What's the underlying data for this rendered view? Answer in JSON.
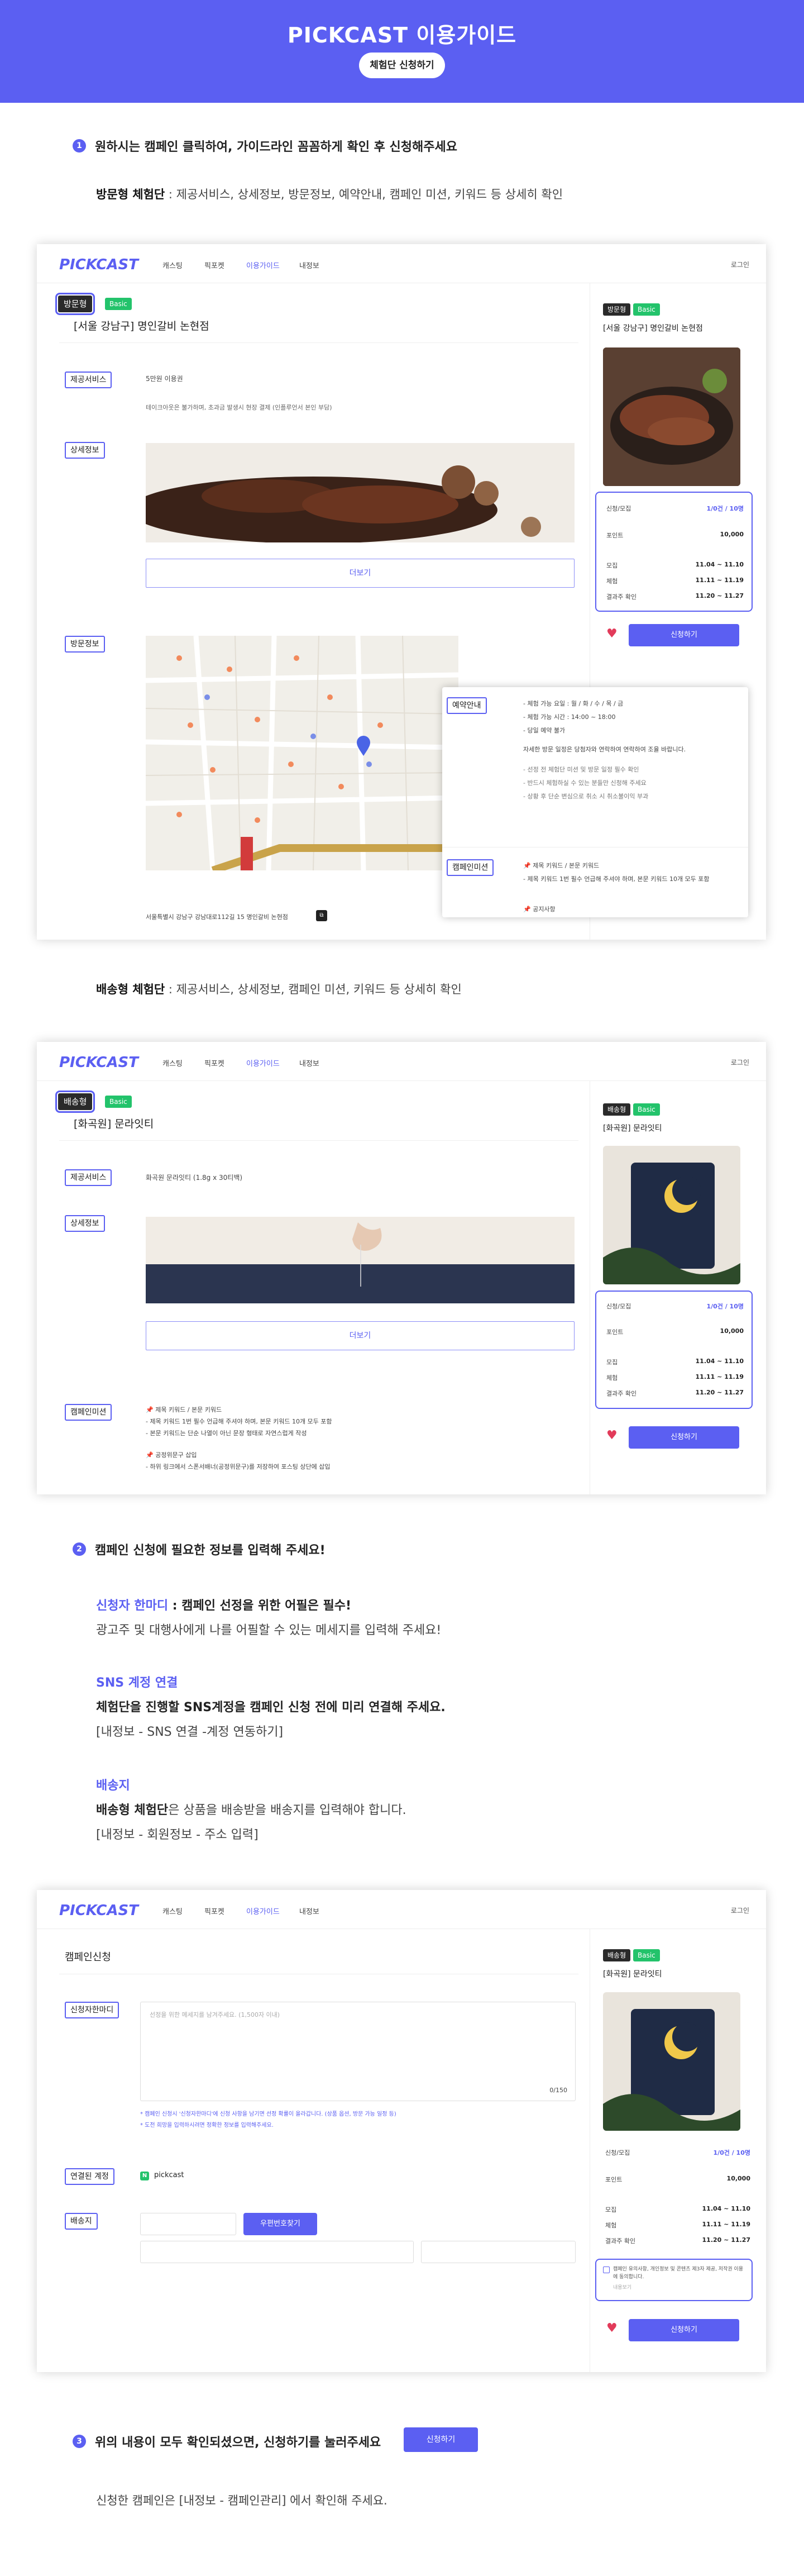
{
  "header": {
    "brand": "PICKCAST",
    "title_suffix": "이용가이드",
    "pill": "체험단 신청하기"
  },
  "step1": {
    "num": "1",
    "text": "원하시는 캠페인 클릭하여, 가이드라인 꼼꼼하게 확인 후 신청해주세요"
  },
  "visit_desc": {
    "bold": "방문형 체험단",
    "rest": " : 제공서비스, 상세정보, 방문정보, 예약안내, 캠페인 미션, 키워드 등 상세히 확인"
  },
  "delivery_desc": {
    "bold": "배송형 체험단",
    "rest": " : 제공서비스, 상세정보, 캠페인 미션, 키워드 등 상세히 확인"
  },
  "nav": {
    "logo": "PICKCAST",
    "items": [
      "캐스팅",
      "픽포켓",
      "이용가이드",
      "내정보"
    ],
    "login": "로그인"
  },
  "frame1": {
    "badge_type": "방문형",
    "badge_tag": "Basic",
    "title": "[서울 강남구] 명인갈비 논현점",
    "service_label": "제공서비스",
    "service_text": "5만원 이용권",
    "service_sub": "테이크아웃은 불가하며, 초과금 발생시 현장 결제 (인플루언서 본인 부담)",
    "detail_label": "상세정보",
    "more_btn": "더보기",
    "visit_label": "방문정보",
    "address": "서울특별시 강남구 강남대로112길 15 명인갈비 논현점",
    "reserve_label": "예약안내",
    "reserve_lines": [
      "- 체험 가능 요일 : 월 / 화 / 수 / 목 / 금",
      "- 체험 가능 시간 : 14:00 ~ 18:00",
      "- 당일 예약 불가",
      "자세한 방문 일정은 당첨자와 연락하여 연락하여 조율 바랍니다.",
      "- 선정 전 체험단 미션 및 방문 일정 필수 확인",
      "- 반드시 체험하실 수 있는 분들만 신청해 주세요",
      "- 상황 후 단순 변심으로 취소 시 취소불이익 부과"
    ],
    "mission_label": "캠페인미션",
    "mission_lines": [
      "📌 제목 키워드 / 본문 키워드",
      "- 제목 키워드 1번 필수 언급해 주셔야 하며, 본문 키워드 10개 모두 포함",
      "📌 공지사항"
    ],
    "side_badge_type": "방문형",
    "side_badge_tag": "Basic",
    "side_title": "[서울 강남구] 명인갈비 논현점",
    "info_rows": [
      [
        "신청/모집",
        "1/0건 / 10명"
      ],
      [
        "포인트",
        "10,000"
      ],
      [
        "모집",
        "11.04 ~ 11.10"
      ],
      [
        "체험",
        "11.11 ~ 11.19"
      ],
      [
        "결과주 확인",
        "11.20 ~ 11.27"
      ]
    ],
    "apply": "신청하기"
  },
  "frame2": {
    "badge_type": "배송형",
    "badge_tag": "Basic",
    "title": "[화곡원] 문라잇티",
    "service_label": "제공서비스",
    "service_text": "화곡원 문라잇티 (1.8g x 30티백)",
    "detail_label": "상세정보",
    "more_btn": "더보기",
    "mission_label": "캠페인미션",
    "mission_lines": [
      "📌 제목 키워드 / 본문 키워드",
      "- 제목 키워드 1번 필수 언급해 주셔야 하며, 본문 키워드 10개 모두 포함",
      "- 본문 키워드는 단순 나열이 아닌 문장 형태로 자연스럽게 작성",
      "📌 공정위문구 삽입",
      "- 하위 링크에서 스폰서배너(공정위문구)를 저장하여 포스팅 상단에 삽입"
    ],
    "side_badge_type": "배송형",
    "side_badge_tag": "Basic",
    "side_title": "[화곡원] 문라잇티",
    "info_rows": [
      [
        "신청/모집",
        "1/0건 / 10명"
      ],
      [
        "포인트",
        "10,000"
      ],
      [
        "모집",
        "11.04 ~ 11.10"
      ],
      [
        "체험",
        "11.11 ~ 11.19"
      ],
      [
        "결과주 확인",
        "11.20 ~ 11.27"
      ]
    ],
    "apply": "신청하기"
  },
  "step2": {
    "num": "2",
    "text": "캠페인 신청에 필요한 정보를 입력해 주세요!"
  },
  "sec2": {
    "a_head": "신청자 한마디",
    "a_tail": " : 캠페인 선정을 위한 어필은 필수!",
    "a_line": "광고주 및 대행사에게 나를 어필할 수 있는 메세지를 입력해 주세요!",
    "b_head": "SNS 계정 연결",
    "b_line1": "체험단을 진행할 SNS계정을 캠페인 신청 전에 미리 연결해 주세요.",
    "b_line2": "[내정보 - SNS 연결 -계정 연동하기]",
    "c_head": "배송지",
    "c_line1_bold": "배송형 체험단",
    "c_line1_rest": "은 상품을 배송받을 배송지를 입력해야 합니다.",
    "c_line2": "[내정보 - 회원정보 - 주소 입력]"
  },
  "frame3": {
    "page_title": "캠페인신청",
    "memo_label": "신청자한마디",
    "memo_placeholder": "선정을 위한 메세지를 남겨주세요. (1,500자 이내)",
    "memo_count": "0/150",
    "notice1": "* 캠페인 신청시 '신청자한마디'에 신청 사항을 남기면 선정 확률이 올라갑니다. (상품 옵션, 방문 가능 일정 등)",
    "notice2": "* 도전 희망을 입력하시려면 정확한 정보를 입력해주세요.",
    "sns_label": "연결된 계정",
    "sns_value": "pickcast",
    "addr_label": "배송지",
    "zip_btn": "우편번호찾기",
    "side_badge_type": "배송형",
    "side_badge_tag": "Basic",
    "side_title": "[화곡원] 문라잇티",
    "info_rows": [
      [
        "신청/모집",
        "1/0건 / 10명"
      ],
      [
        "포인트",
        "10,000"
      ],
      [
        "모집",
        "11.04 ~ 11.10"
      ],
      [
        "체험",
        "11.11 ~ 11.19"
      ],
      [
        "결과주 확인",
        "11.20 ~ 11.27"
      ]
    ],
    "agree_text": "캠페인 유의사항, 개인정보 및 콘텐츠 제3자 제공, 저작권 이용에 동의합니다.",
    "agree_link": "내용보기",
    "apply": "신청하기"
  },
  "step3": {
    "num": "3",
    "text": "위의 내용이 모두 확인되셨으면, 신청하기를 눌러주세요",
    "button": "신청하기"
  },
  "final_line": "신청한 캠페인은 [내정보 - 캠페인관리] 에서 확인해 주세요.",
  "colors": {
    "accent": "#5b5ff2",
    "green": "#23c36b",
    "heart": "#e23b5a"
  }
}
